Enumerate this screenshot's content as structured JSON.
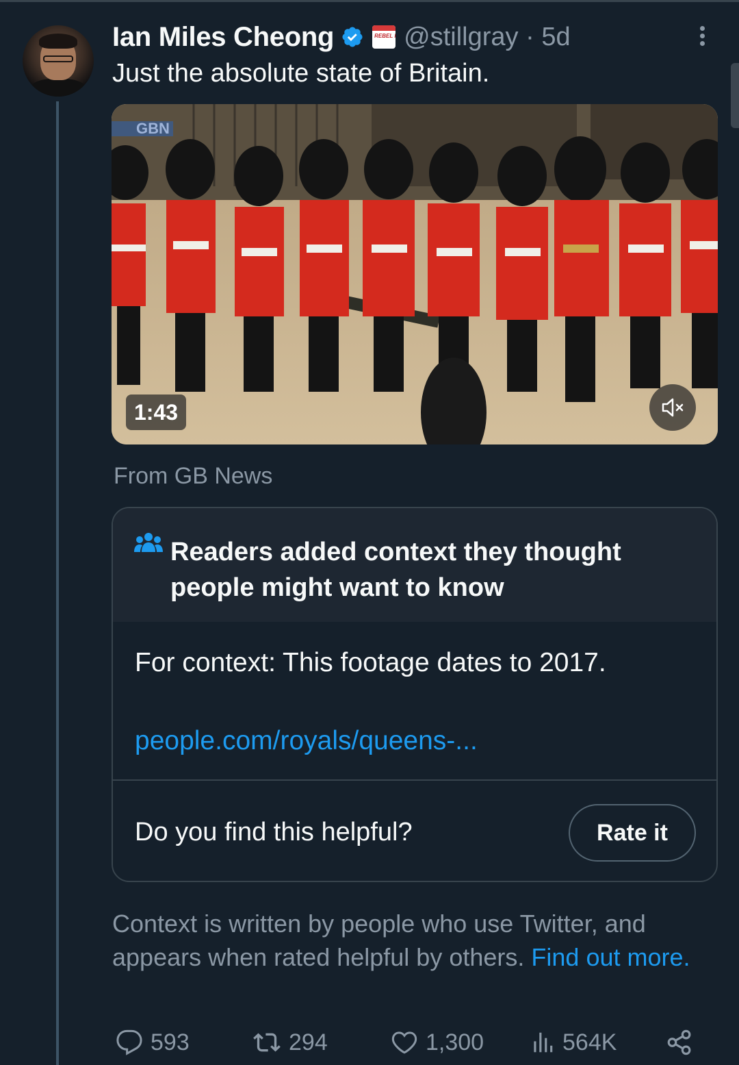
{
  "tweet": {
    "author_name": "Ian Miles Cheong",
    "handle": "@stillgray",
    "separator": "·",
    "time": "5d",
    "text": "Just the absolute state of Britain.",
    "affiliate_badge_text": "REBEL NEWS",
    "media": {
      "watermark": "GBN",
      "duration": "1:43",
      "sound": "muted"
    },
    "source": "From GB News"
  },
  "community_note": {
    "title": "Readers added context they thought people might want to know",
    "body": "For context: This footage dates to 2017.",
    "link": "people.com/royals/queens-...",
    "helpful_prompt": "Do you find this helpful?",
    "rate_button": "Rate it"
  },
  "disclaimer": {
    "text": "Context is written by people who use Twitter, and appears when rated helpful by others.",
    "link": "Find out more."
  },
  "actions": {
    "replies": "593",
    "retweets": "294",
    "likes": "1,300",
    "views": "564K"
  },
  "colors": {
    "background": "#15202b",
    "accent": "#1d9bf0",
    "muted_text": "#8b98a5",
    "verified": "#1d9bf0"
  },
  "icons": [
    "more-icon",
    "verified-badge-icon",
    "affiliate-badge-icon",
    "mute-icon",
    "people-icon",
    "reply-icon",
    "retweet-icon",
    "like-icon",
    "views-icon",
    "share-icon"
  ]
}
